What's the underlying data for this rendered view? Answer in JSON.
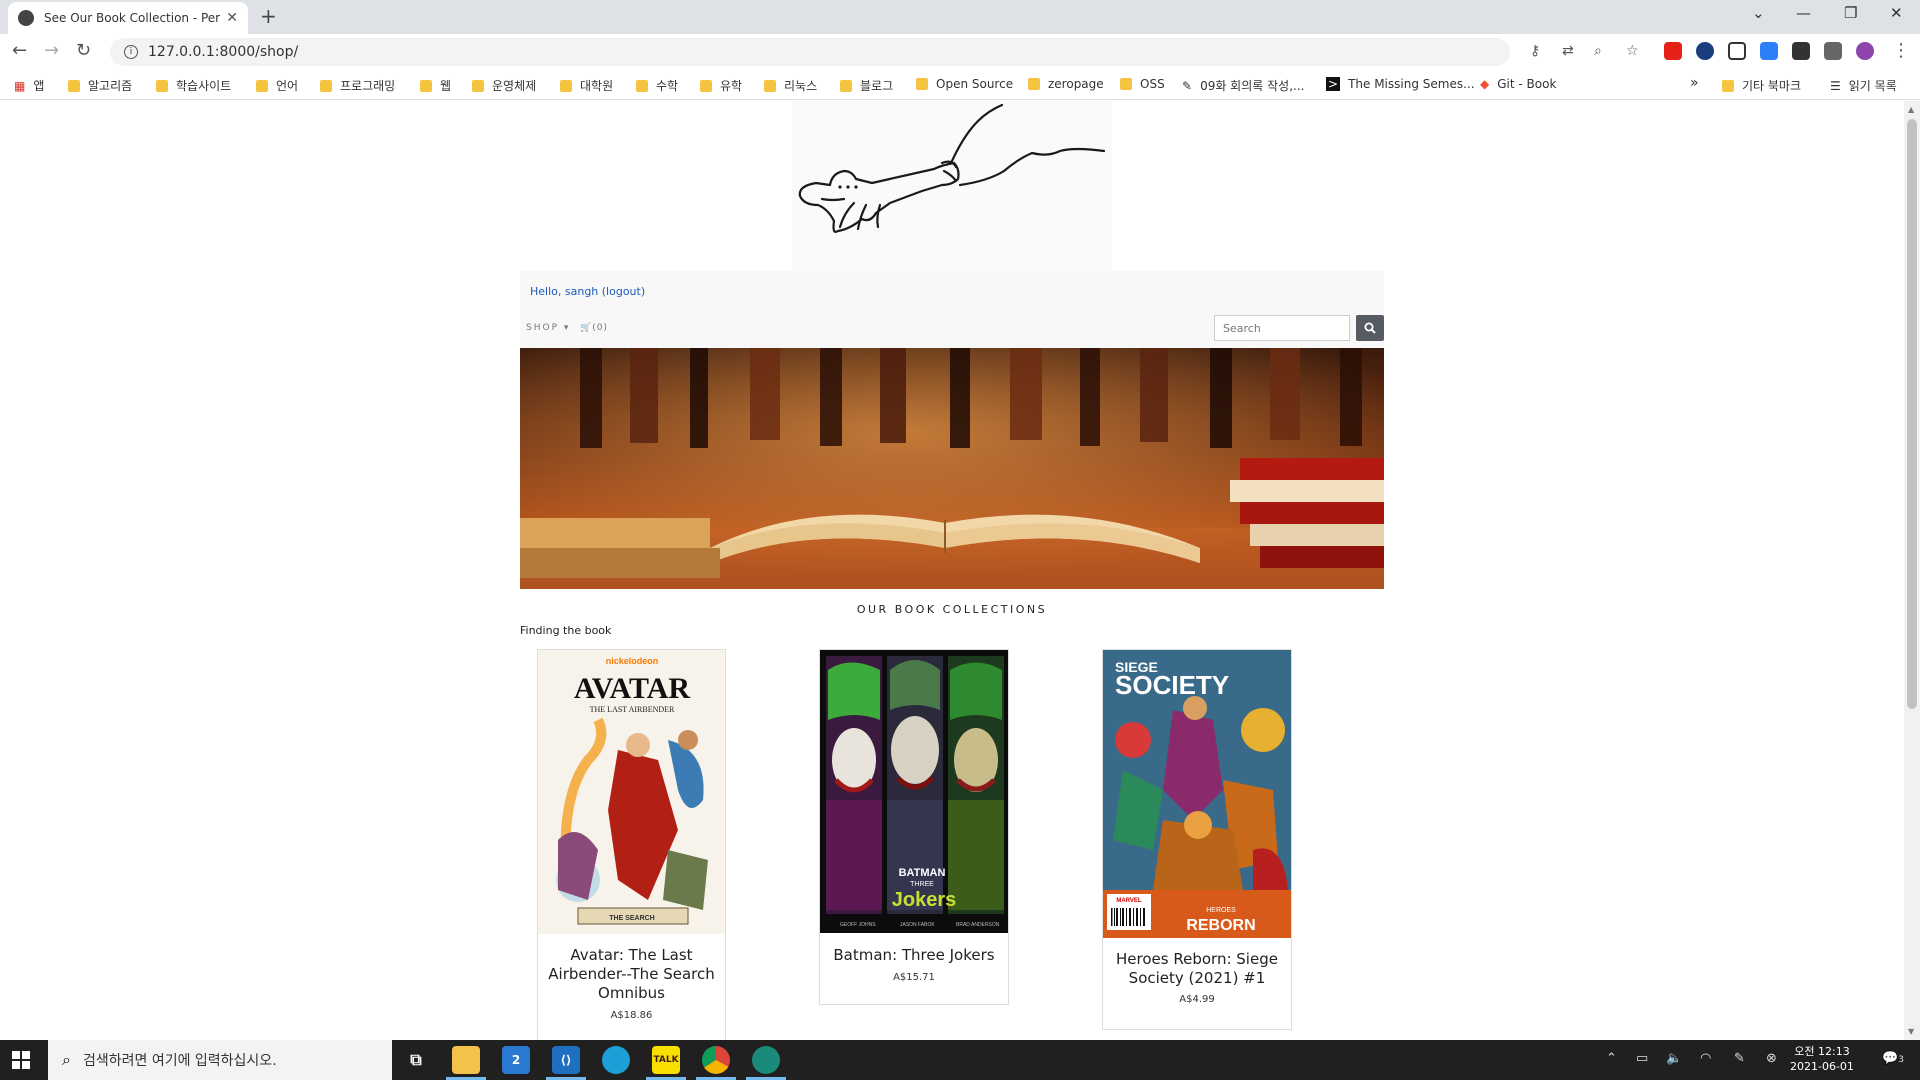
{
  "browser": {
    "tab_title": "See Our Book Collection - Perfe",
    "new_tab": "+",
    "address": "127.0.0.1:8000/shop/",
    "window_controls": {
      "minimize": "—",
      "restore": "❐",
      "close": "✕"
    }
  },
  "bookmarks": {
    "apps_label": "앱",
    "items": [
      {
        "label": "알고리즘",
        "icon": "folder-icon"
      },
      {
        "label": "학습사이트",
        "icon": "folder-icon"
      },
      {
        "label": "언어",
        "icon": "folder-icon"
      },
      {
        "label": "프로그래밍",
        "icon": "folder-icon"
      },
      {
        "label": "웹",
        "icon": "folder-icon"
      },
      {
        "label": "운영체제",
        "icon": "folder-icon"
      },
      {
        "label": "대학원",
        "icon": "folder-icon"
      },
      {
        "label": "수학",
        "icon": "folder-icon"
      },
      {
        "label": "유학",
        "icon": "folder-icon"
      },
      {
        "label": "리눅스",
        "icon": "folder-icon"
      },
      {
        "label": "블로그",
        "icon": "folder-icon"
      },
      {
        "label": "Open Source",
        "icon": "folder-icon"
      },
      {
        "label": "zeropage",
        "icon": "folder-icon"
      },
      {
        "label": "OSS",
        "icon": "folder-icon"
      },
      {
        "label": "09화 회의록 작성,...",
        "icon": "pen-icon"
      },
      {
        "label": "The Missing Semes...",
        "icon": "terminal-icon"
      },
      {
        "label": "Git - Book",
        "icon": "git-icon"
      }
    ],
    "more": "»",
    "other_bookmarks": "기타 북마크",
    "reading_list": "읽기 목록"
  },
  "shop": {
    "greeting": "Hello, sangh (logout)",
    "nav_shop": "SHOP ▾",
    "nav_cart": "🛒(0)",
    "search_placeholder": "Search",
    "collections_heading": "OUR BOOK COLLECTIONS",
    "finding_label": "Finding the book",
    "books": [
      {
        "title": "Avatar: The Last Airbender--The Search Omnibus",
        "price": "A$18.86"
      },
      {
        "title": "Batman: Three Jokers",
        "price": "A$15.71"
      },
      {
        "title": "Heroes Reborn: Siege Society (2021) #1",
        "price": "A$4.99"
      }
    ],
    "cover_text": {
      "avatar_brand": "nickelodeon",
      "avatar_title": "AVATAR",
      "avatar_sub": "THE LAST AIRBENDER",
      "avatar_banner": "THE SEARCH",
      "batman_title": "BATMAN",
      "batman_sub": "THREE",
      "batman_jokers": "Jokers",
      "batman_credits": [
        "GEOFF JOHNS",
        "JASON FABOK",
        "BRAD ANDERSON"
      ],
      "siege_line1": "SIEGE",
      "siege_line2": "SOCIETY",
      "siege_heroes": "HEROES",
      "siege_reborn": "REBORN",
      "siege_publisher": "MARVEL"
    }
  },
  "taskbar": {
    "search_placeholder": "검색하려면 여기에 입력하십시오.",
    "mail_badge": "2",
    "kakao_label": "TALK",
    "clock_time": "오전 12:13",
    "clock_date": "2021-06-01",
    "notif_count": "3"
  },
  "colors": {
    "link": "#1a5bb8",
    "search_button": "#555b61",
    "taskbar": "#202020",
    "folder": "#f5c542"
  }
}
